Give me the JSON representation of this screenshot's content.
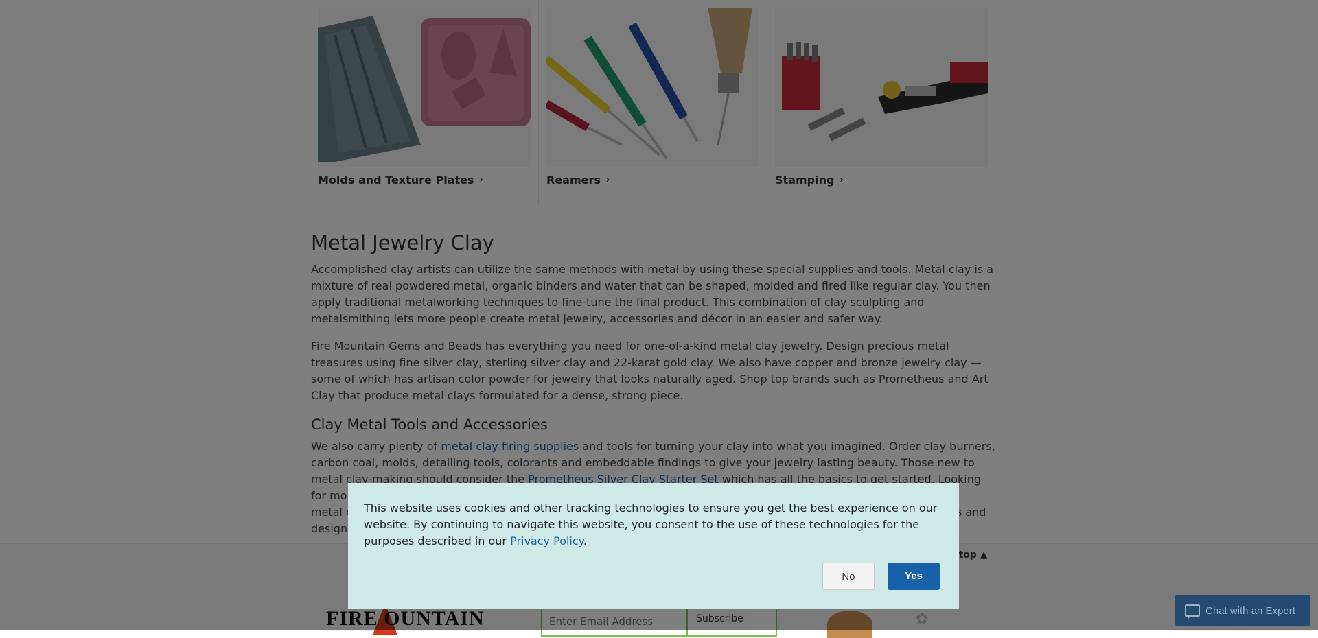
{
  "categories": [
    {
      "label": "Molds and Texture Plates",
      "image": "molds-texture-plates-photo"
    },
    {
      "label": "Reamers",
      "image": "reamers-photo"
    },
    {
      "label": "Stamping",
      "image": "stamping-tools-photo"
    }
  ],
  "article": {
    "title": "Metal Jewelry Clay",
    "p1": "Accomplished clay artists can utilize the same methods with metal by using these special supplies and tools. Metal clay is a mixture of real powdered metal, organic binders and water that can be shaped, molded and fired like regular clay. You then apply traditional metalworking techniques to fine-tune the final product. This combination of clay sculpting and metalsmithing lets more people create metal jewelry, accessories and décor in an easier and safer way.",
    "p2": "Fire Mountain Gems and Beads has everything you need for one-of-a-kind metal clay jewelry. Design precious metal treasures using fine silver clay, sterling silver clay and 22-karat gold clay. We also have copper and bronze jewelry clay — some of which has artisan color powder for jewelry that looks naturally aged. Shop top brands such as Prometheus and Art Clay that produce metal clays formulated for a dense, strong piece.",
    "subtitle": "Clay Metal Tools and Accessories",
    "p3_a": "We also carry plenty of ",
    "p3_link1": "metal clay firing supplies",
    "p3_b": " and tools for turning your clay into what you imagined. Order clay burners, carbon coal, molds, detailing tools, colorants and embeddable findings to give your jewelry lasting beauty. Those new to metal clay-making should consider the ",
    "p3_link2": "Prometheus Silver Clay Starter Set",
    "p3_c": " which has all the basics to get started. Looking for more information about",
    "p3_d": "metal c",
    "p3_e": "s and",
    "p3_f": "designe"
  },
  "footer": {
    "back_to_top": "o top",
    "logo_text": "FIRE  OUNTAIN",
    "email_placeholder": "Enter Email Address",
    "subscribe_label": "Subscribe"
  },
  "cookie": {
    "message_before": "This website uses cookies and other tracking technologies to ensure you get the best experience on our website. By continuing to navigate this website, you consent to the use of these technologies for the purposes described in our ",
    "privacy_link": "Privacy Policy",
    "message_after": ".",
    "no_label": "No",
    "yes_label": "Yes"
  },
  "chat": {
    "label": "Chat with an Expert"
  },
  "colors": {
    "primary_button": "#1661a9",
    "modal_bg": "#cfe9e6",
    "chat_bg": "#244a72",
    "link": "#1a5fa8"
  }
}
